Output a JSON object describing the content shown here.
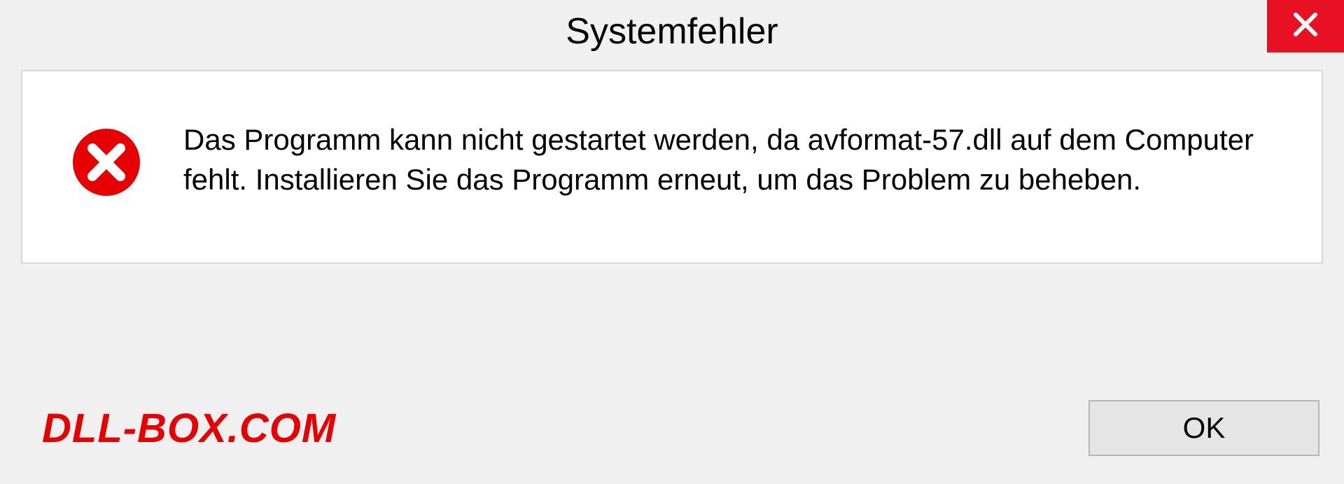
{
  "dialog": {
    "title": "Systemfehler",
    "message": "Das Programm kann nicht gestartet werden, da avformat-57.dll auf dem Computer fehlt. Installieren Sie das Programm erneut, um das Problem zu beheben.",
    "ok_label": "OK"
  },
  "watermark": "DLL-BOX.COM"
}
